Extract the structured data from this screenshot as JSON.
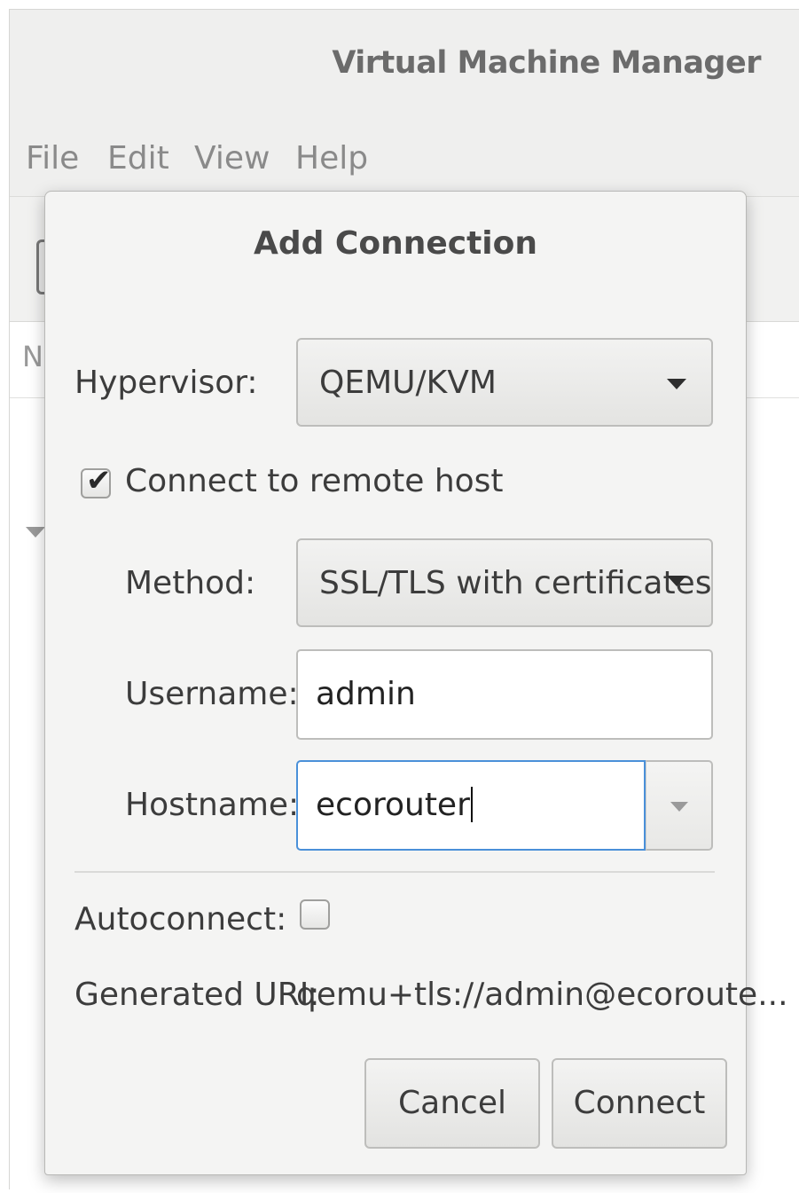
{
  "window": {
    "title": "Virtual Machine Manager",
    "menu": [
      "File",
      "Edit",
      "View",
      "Help"
    ],
    "list_header_stub": "N"
  },
  "dialog": {
    "title": "Add Connection",
    "hypervisor": {
      "label": "Hypervisor:",
      "value": "QEMU/KVM"
    },
    "remote": {
      "label": "Connect to remote host",
      "checked": true
    },
    "method": {
      "label": "Method:",
      "value": "SSL/TLS with certificates"
    },
    "username": {
      "label": "Username:",
      "value": "admin"
    },
    "hostname": {
      "label": "Hostname:",
      "value": "ecorouter"
    },
    "autoconnect": {
      "label": "Autoconnect:",
      "checked": false
    },
    "uri": {
      "label": "Generated URI:",
      "value": "qemu+tls://admin@ecoroute..."
    },
    "buttons": {
      "cancel": "Cancel",
      "connect": "Connect"
    }
  },
  "icons": {
    "dropdown": "triangle-down-icon",
    "check": "checkmark-icon",
    "expander": "expander-arrow-icon"
  },
  "colors": {
    "focus_border": "#4a90d9",
    "dialog_bg": "#f4f4f3",
    "window_bg": "#f6f6f5"
  }
}
